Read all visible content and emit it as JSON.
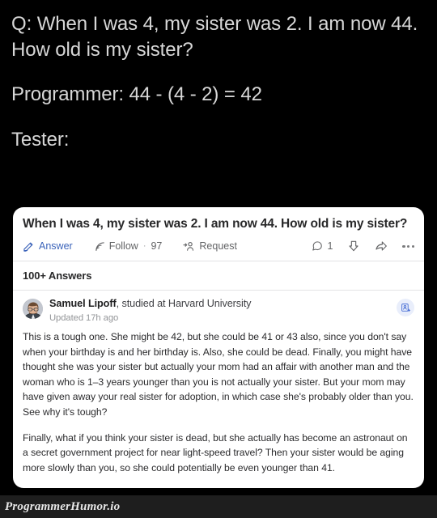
{
  "meme": {
    "question_line": "Q: When I was 4, my sister was 2. I am now 44. How old is my sister?",
    "programmer_line": "Programmer: 44 - (4 - 2) = 42",
    "tester_line": "Tester:"
  },
  "colors": {
    "background": "#000000",
    "caption_text": "#d7d7d7",
    "card_background": "#ffffff",
    "quora_blue": "#3c64ba",
    "muted_text": "#636466",
    "divider": "#e3e3e5",
    "follow_badge_bg": "#e9eefb",
    "watermark_bar": "#1e1e1e"
  },
  "card": {
    "question_title": "When I was 4, my sister was 2. I am now 44. How old is my sister?",
    "actions": {
      "answer": {
        "label": "Answer",
        "icon": "pencil-edit-icon"
      },
      "follow": {
        "label": "Follow",
        "separator": "·",
        "count": "97",
        "icon": "rss-follow-icon"
      },
      "request": {
        "label": "Request",
        "icon": "request-person-icon"
      },
      "comment": {
        "count": "1",
        "icon": "comment-bubble-icon"
      },
      "downvote": {
        "icon": "downvote-arrow-icon"
      },
      "share": {
        "icon": "share-arrow-icon"
      },
      "more": {
        "icon": "more-options-icon"
      }
    },
    "answers_count": "100+ Answers",
    "author": {
      "name": "Samuel Lipoff",
      "credential": ", studied at Harvard University",
      "updated": "Updated 17h ago",
      "avatar_icon": "user-photo-avatar",
      "follow_user_icon": "add-person-icon"
    },
    "answer_paragraphs": [
      "This is a tough one. She might be 42, but she could be 41 or 43 also, since you don't say when your birthday is and her birthday is. Also, she could be dead. Finally, you might have thought she was your sister but actually your mom had an affair with another man and the woman who is 1–3 years younger than you is not actually your sister. But your mom may have given away your real sister for adoption, in which case she's probably older than you. See why it's tough?",
      "Finally, what if you think your sister is dead, but she actually has become an astronaut on a secret government project for near light-speed travel? Then your sister would be aging more slowly than you, so she could potentially be even younger than 41."
    ]
  },
  "watermark": {
    "text": "ProgrammerHumor.io"
  }
}
